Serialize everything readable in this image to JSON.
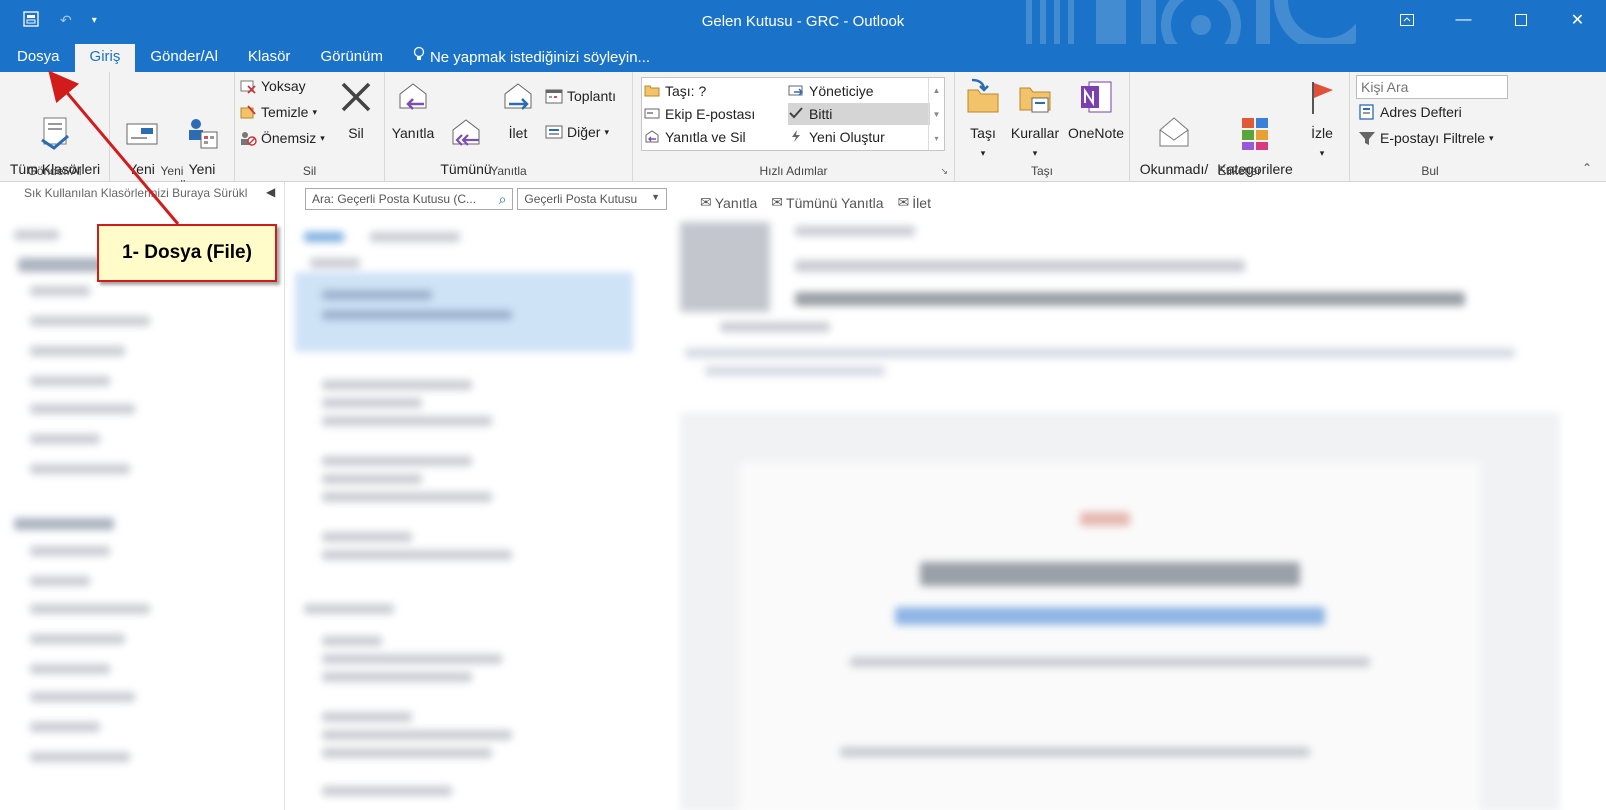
{
  "window": {
    "title": "Gelen Kutusu - GRC - Outlook"
  },
  "tabs": [
    {
      "label": "Dosya"
    },
    {
      "label": "Giriş"
    },
    {
      "label": "Gönder/Al"
    },
    {
      "label": "Klasör"
    },
    {
      "label": "Görünüm"
    }
  ],
  "tell_me": "Ne yapmak istediğinizi söyleyin...",
  "ribbon": {
    "gonder_al": {
      "label": "Gönder/Al",
      "all_folders": "Tüm Klasörleri\nGönder/Al"
    },
    "yeni": {
      "label": "Yeni",
      "new_email": "Yeni\nE-posta",
      "new_items": "Yeni\nÖğeler"
    },
    "sil": {
      "label": "Sil",
      "ignore": "Yoksay",
      "clean": "Temizle",
      "junk": "Önemsiz",
      "delete": "Sil"
    },
    "yanitla": {
      "label": "Yanıtla",
      "reply": "Yanıtla",
      "reply_all": "Tümünü\nYanıtla",
      "forward": "İlet",
      "meeting": "Toplantı",
      "more": "Diğer"
    },
    "hizli": {
      "label": "Hızlı Adımlar",
      "items": [
        "Taşı: ?",
        "Yöneticiye",
        "Ekip E-postası",
        "Bitti",
        "Yanıtla ve Sil",
        "Yeni Oluştur"
      ]
    },
    "tasi": {
      "label": "Taşı",
      "move": "Taşı",
      "rules": "Kurallar",
      "onenote": "OneNote"
    },
    "etiketler": {
      "label": "Etiketler",
      "unread": "Okunmadı/\nOkundu",
      "categorize": "Kategorilere\nAyır",
      "follow": "İzle"
    },
    "bul": {
      "label": "Bul",
      "people_search": "Kişi Ara",
      "address_book": "Adres Defteri",
      "filter_email": "E-postayı Filtrele"
    }
  },
  "folder_pane": {
    "favorites_hint": "Sık Kullanılan Klasörlerinizi Buraya Sürükl"
  },
  "search": {
    "placeholder": "Ara: Geçerli Posta Kutusu (C...",
    "scope": "Geçerli Posta Kutusu"
  },
  "reading_toolbar": {
    "reply": "Yanıtla",
    "reply_all": "Tümünü Yanıtla",
    "forward": "İlet"
  },
  "callout": {
    "text": "1- Dosya (File)"
  },
  "colors": {
    "accent": "#1a73c8",
    "ribbon_bg": "#f3f3f3",
    "callout_border": "#d21c1c",
    "callout_bg": "#fffcc9"
  }
}
